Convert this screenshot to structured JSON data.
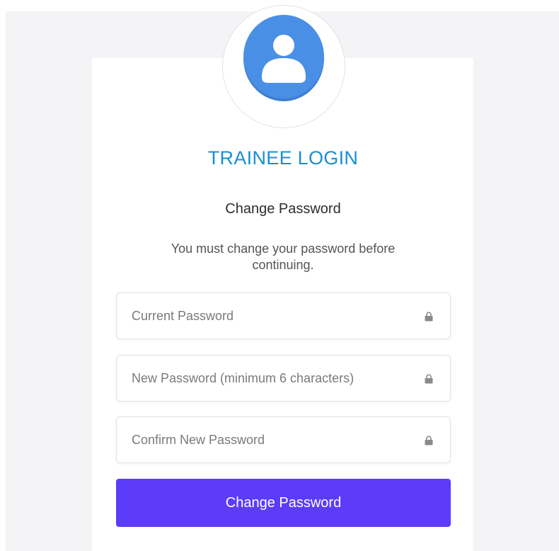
{
  "header": {
    "title": "TRAINEE LOGIN",
    "subtitle": "Change Password",
    "message": "You must change your password before continuing."
  },
  "avatar": {
    "icon": "user-avatar-icon",
    "color": "#4a8fe6"
  },
  "form": {
    "current_password": {
      "placeholder": "Current Password",
      "value": "",
      "icon": "lock-icon"
    },
    "new_password": {
      "placeholder": "New Password (minimum 6 characters)",
      "value": "",
      "icon": "lock-icon"
    },
    "confirm_password": {
      "placeholder": "Confirm New Password",
      "value": "",
      "icon": "lock-icon"
    },
    "submit_label": "Change Password"
  },
  "colors": {
    "title": "#1b8fd2",
    "button": "#5c3cf8",
    "background": "#f4f4f7"
  }
}
